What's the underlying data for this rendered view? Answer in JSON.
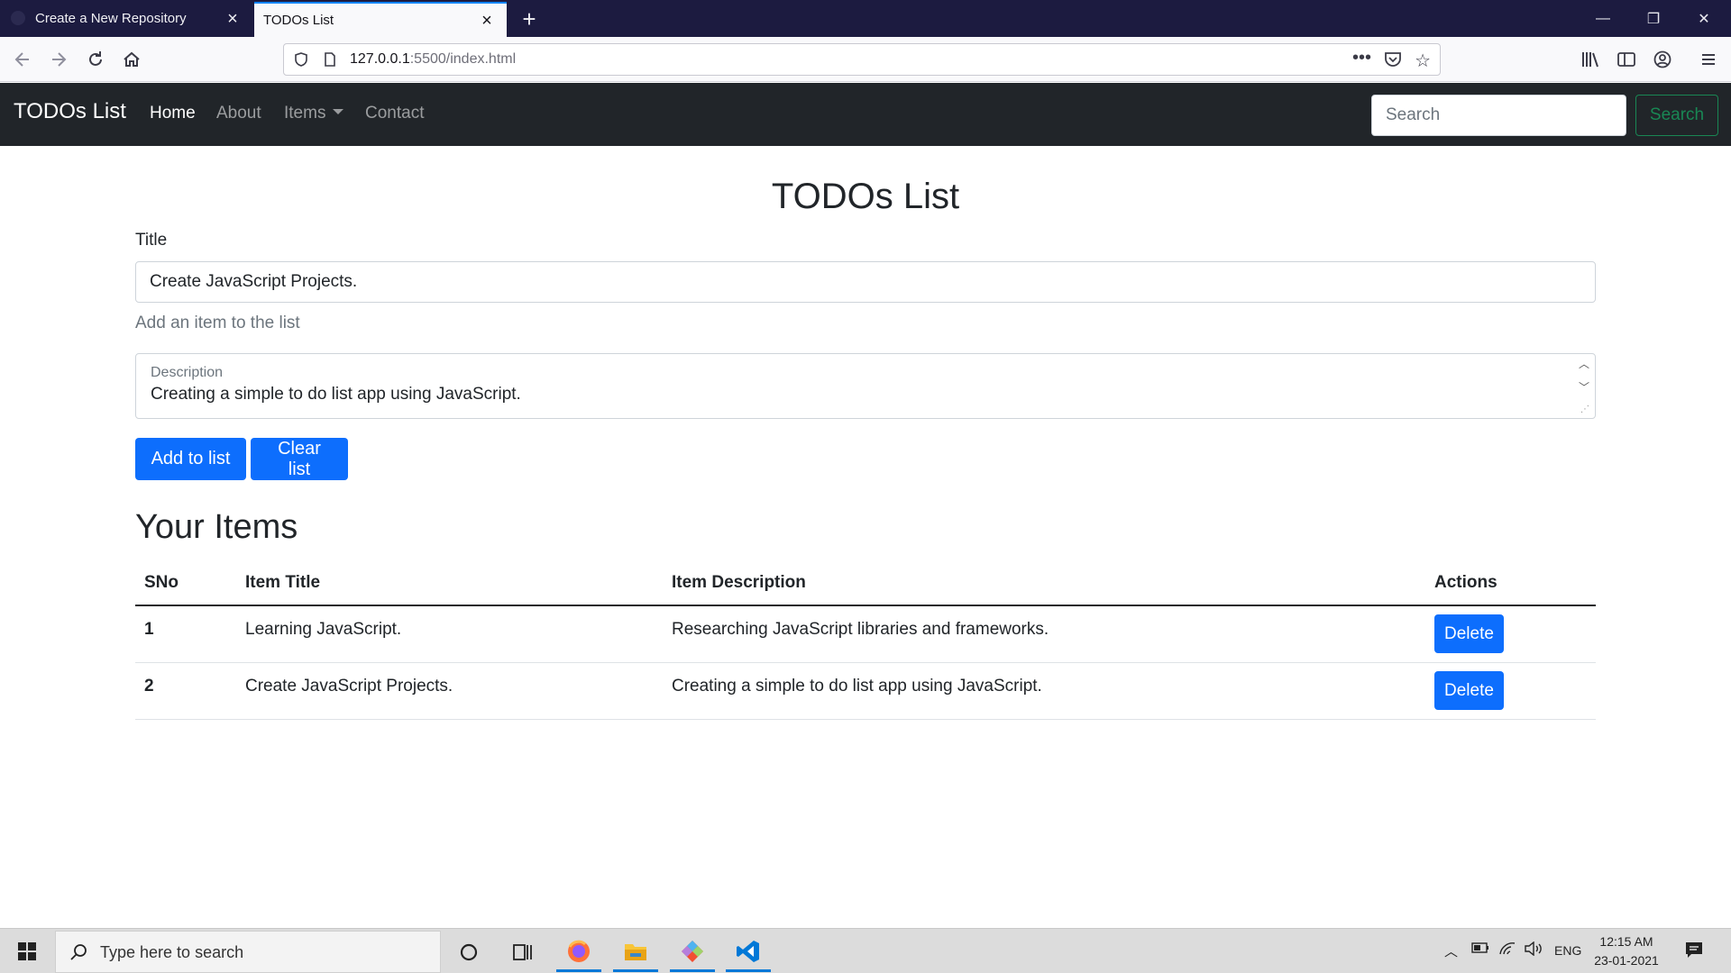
{
  "browser": {
    "tabs": [
      {
        "label": "Create a New Repository",
        "close": "×"
      },
      {
        "label": "TODOs List",
        "close": "×"
      }
    ],
    "new_tab": "+",
    "url_host": "127.0.0.1",
    "url_rest": ":5500/index.html",
    "window_controls": {
      "minimize": "—",
      "restore": "❐",
      "close": "✕"
    }
  },
  "site": {
    "brand": "TODOs List",
    "nav": [
      {
        "label": "Home",
        "active": true
      },
      {
        "label": "About"
      },
      {
        "label": "Items"
      },
      {
        "label": "Contact"
      }
    ],
    "search_placeholder": "Search",
    "search_button": "Search"
  },
  "form": {
    "heading": "TODOs List",
    "title_label": "Title",
    "title_value": "Create JavaScript Projects.",
    "help_text": "Add an item to the list",
    "description_label": "Description",
    "description_value": "Creating a simple to do list app using JavaScript.",
    "add_button": "Add to list",
    "clear_button": "Clear list"
  },
  "items": {
    "heading": "Your Items",
    "columns": [
      "SNo",
      "Item Title",
      "Item Description",
      "Actions"
    ],
    "rows": [
      {
        "sno": "1",
        "title": "Learning JavaScript.",
        "description": "Researching JavaScript libraries and frameworks.",
        "action": "Delete"
      },
      {
        "sno": "2",
        "title": "Create JavaScript Projects.",
        "description": "Creating a simple to do list app using JavaScript.",
        "action": "Delete"
      }
    ]
  },
  "taskbar": {
    "search_placeholder": "Type here to search",
    "language": "ENG",
    "time": "12:15 AM",
    "date": "23-01-2021"
  }
}
